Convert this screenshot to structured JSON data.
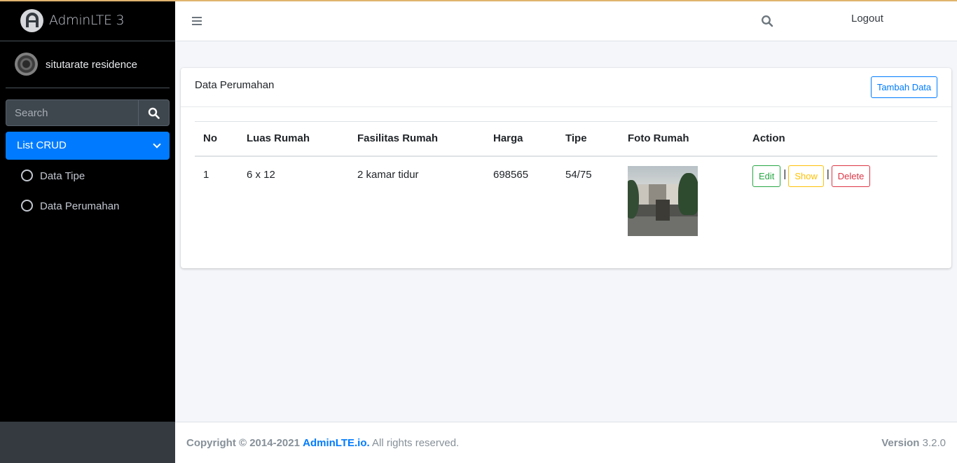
{
  "brand": {
    "name": "AdminLTE 3"
  },
  "user": {
    "name": "situtarate residence"
  },
  "sidebar": {
    "search_placeholder": "Search",
    "active_item": {
      "label": "List CRUD"
    },
    "items": [
      {
        "label": "Data Tipe"
      },
      {
        "label": "Data Perumahan"
      }
    ]
  },
  "navbar": {
    "logout_label": "Logout"
  },
  "card": {
    "title": "Data Perumahan",
    "add_button": "Tambah Data"
  },
  "table": {
    "headers": [
      "No",
      "Luas Rumah",
      "Fasilitas Rumah",
      "Harga",
      "Tipe",
      "Foto Rumah",
      "Action"
    ],
    "rows": [
      {
        "no": "1",
        "luas": "6 x 12",
        "fasilitas": "2 kamar tidur",
        "harga": "698565",
        "tipe": "54/75",
        "actions": {
          "edit": "Edit",
          "show": "Show",
          "delete": "Delete",
          "separator": "|"
        }
      }
    ]
  },
  "footer": {
    "copyright": "Copyright © 2014-2021",
    "link_text": "AdminLTE.io.",
    "rights": "All rights reserved.",
    "version_label": "Version",
    "version_value": "3.2.0"
  },
  "colors": {
    "primary": "#007bff",
    "success": "#28a745",
    "warning": "#ffc107",
    "danger": "#dc3545",
    "sidebar_bg": "#000000"
  }
}
